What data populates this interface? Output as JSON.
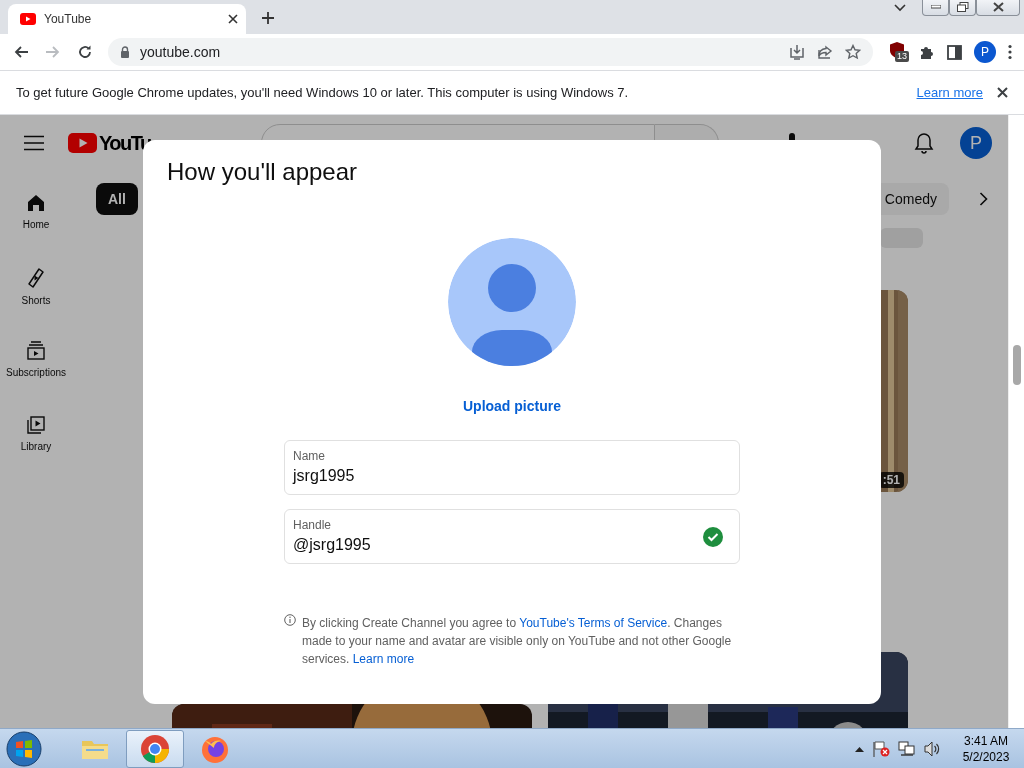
{
  "browser": {
    "tabs": [
      {
        "title": "YouTube",
        "selected": true
      }
    ],
    "nav": [
      {
        "kind": "back",
        "disabled": false
      },
      {
        "kind": "forward",
        "disabled": true
      },
      {
        "kind": "reload",
        "disabled": false
      }
    ],
    "url": "youtube.com",
    "extension_badge": "13",
    "profile": "P"
  },
  "infobar": {
    "message": "To get future Google Chrome updates, you'll need Windows 10 or later. This computer is using Windows 7.",
    "link": "Learn more"
  },
  "youtube": {
    "logo": "YouTu",
    "avatar": "P",
    "sidebar": [
      {
        "kind": "home",
        "label": "Home",
        "selected": true
      },
      {
        "kind": "shorts",
        "label": "Shorts",
        "selected": false
      },
      {
        "kind": "subscriptions",
        "label": "Subscriptions",
        "selected": false
      },
      {
        "kind": "library",
        "label": "Library",
        "selected": false
      }
    ],
    "chips": [
      {
        "label": "All",
        "selected": true
      },
      {
        "label": "Comedy",
        "selected": false
      }
    ],
    "duration": ":51"
  },
  "dialog": {
    "title": "How you'll appear",
    "upload": "Upload picture",
    "fields": [
      {
        "label": "Name",
        "value": "jsrg1995",
        "valid": false
      },
      {
        "label": "Handle",
        "value": "@jsrg1995",
        "valid": true
      }
    ],
    "notice": [
      {
        "kind": "text",
        "text": "By clicking Create Channel you agree to "
      },
      {
        "kind": "link",
        "text": "YouTube's Terms of Service"
      },
      {
        "kind": "text",
        "text": ". Changes made to your name and avatar are visible only on YouTube and not other Google services. "
      },
      {
        "kind": "link",
        "text": "Learn more"
      }
    ]
  },
  "taskbar": {
    "apps": [
      {
        "kind": "explorer",
        "active": false
      },
      {
        "kind": "chrome",
        "active": true
      },
      {
        "kind": "firefox",
        "active": false
      }
    ],
    "clock": {
      "time": "3:41 AM",
      "date": "5/2/2023"
    }
  }
}
